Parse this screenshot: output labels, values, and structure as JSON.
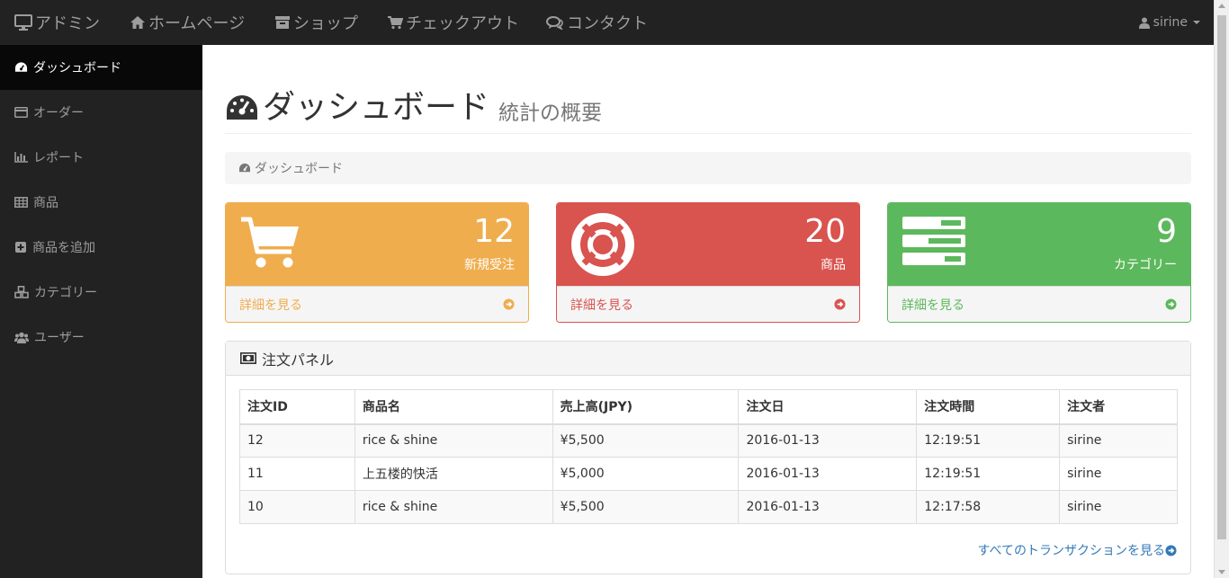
{
  "navbar": {
    "brand": "アドミン",
    "links": [
      "ホームページ",
      "ショップ",
      "チェックアウト",
      "コンタクト"
    ],
    "user": "sirine"
  },
  "sidebar": {
    "items": [
      {
        "label": "ダッシュボード",
        "icon": "dashboard-icon",
        "active": true
      },
      {
        "label": "オーダー",
        "icon": "credit-card-icon"
      },
      {
        "label": "レポート",
        "icon": "bar-chart-icon"
      },
      {
        "label": "商品",
        "icon": "table-icon"
      },
      {
        "label": "商品を追加",
        "icon": "plus-square-icon"
      },
      {
        "label": "カテゴリー",
        "icon": "cubes-icon"
      },
      {
        "label": "ユーザー",
        "icon": "users-icon"
      }
    ]
  },
  "header": {
    "title": "ダッシュボード",
    "subtitle": "統計の概要"
  },
  "breadcrumb": "ダッシュボード",
  "stats": [
    {
      "value": "12",
      "label": "新規受注",
      "link": "詳細を見る",
      "icon": "shopping-cart-icon",
      "color": "#f0ad4e"
    },
    {
      "value": "20",
      "label": "商品",
      "link": "詳細を見る",
      "icon": "life-ring-icon",
      "color": "#d9534f"
    },
    {
      "value": "9",
      "label": "カテゴリー",
      "link": "詳細を見る",
      "icon": "tasks-icon",
      "color": "#5cb85c"
    }
  ],
  "orders_panel": {
    "title": "注文パネル",
    "columns": [
      "注文ID",
      "商品名",
      "売上高(JPY)",
      "注文日",
      "注文時間",
      "注文者"
    ],
    "rows": [
      [
        "12",
        "rice & shine",
        "¥5,500",
        "2016-01-13",
        "12:19:51",
        "sirine"
      ],
      [
        "11",
        "上五楼的快活",
        "¥5,000",
        "2016-01-13",
        "12:19:51",
        "sirine"
      ],
      [
        "10",
        "rice & shine",
        "¥5,500",
        "2016-01-13",
        "12:17:58",
        "sirine"
      ]
    ],
    "view_all": "すべてのトランザクションを見る"
  }
}
